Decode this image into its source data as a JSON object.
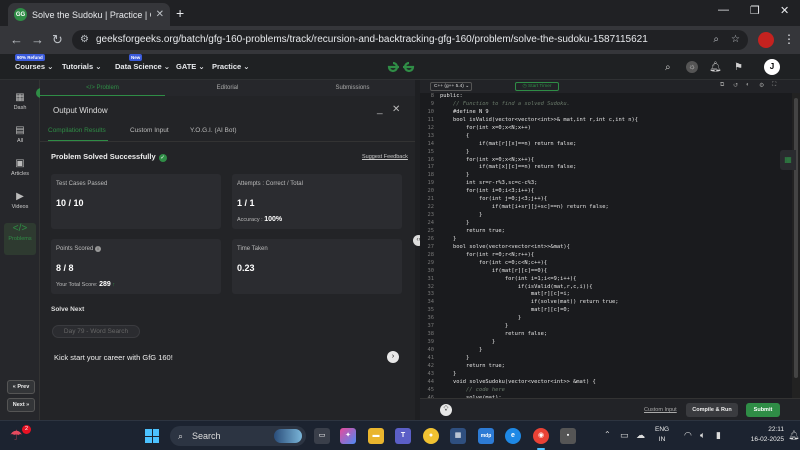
{
  "browser": {
    "tab_title": "Solve the Sudoku | Practice | Ge",
    "new_tab": "+",
    "url": "geeksforgeeks.org/batch/gfg-160-problems/track/recursion-and-backtracking-gfg-160/problem/solve-the-sudoku-1587115621"
  },
  "gfg_header": {
    "nav": [
      {
        "label": "Courses ⌄",
        "badge": "90% Refund"
      },
      {
        "label": "Tutorials ⌄",
        "badge": ""
      },
      {
        "label": "Data Science ⌄",
        "badge": "New"
      },
      {
        "label": "GATE ⌄",
        "badge": ""
      },
      {
        "label": "Practice ⌄",
        "badge": ""
      }
    ],
    "avatar_letter": "J"
  },
  "rail": {
    "items": [
      {
        "label": "Dash",
        "icon": "dashboard-icon"
      },
      {
        "label": "All",
        "icon": "grid-icon"
      },
      {
        "label": "Articles",
        "icon": "article-icon"
      },
      {
        "label": "Videos",
        "icon": "video-icon"
      },
      {
        "label": "Problems",
        "icon": "code-icon"
      }
    ],
    "prev": "« Prev",
    "next": "Next »"
  },
  "problem_tabs": [
    "</> Problem",
    "Editorial",
    "Submissions"
  ],
  "output": {
    "title": "Output Window",
    "tabs": [
      "Compilation Results",
      "Custom Input",
      "Y.O.G.I. (AI Bot)"
    ],
    "status": "Problem Solved Successfully",
    "feedback": "Suggest Feedback",
    "cards": {
      "tests_label": "Test Cases Passed",
      "tests_value": "10 / 10",
      "attempts_label": "Attempts : Correct / Total",
      "attempts_value": "1 / 1",
      "accuracy_label": "Accuracy :",
      "accuracy_value": "100%",
      "points_label": "Points Scored",
      "points_value": "8 / 8",
      "total_label": "Your Total Score:",
      "total_value": "289",
      "time_label": "Time Taken",
      "time_value": "0.23"
    },
    "solve_next": "Solve Next",
    "potd": "Day 79 - Word Search",
    "kickstart": "Kick start your career with GfG 160!"
  },
  "editor": {
    "language": "C++ (g++ 5.4)",
    "timer": "Start Timer",
    "lines": [
      {
        "n": "8",
        "t": "public:",
        "c": "kw"
      },
      {
        "n": "9",
        "t": "    // Function to find a solved Sudoku.",
        "c": "cm"
      },
      {
        "n": "10",
        "t": "    #define N 9",
        "c": "kw"
      },
      {
        "n": "11",
        "t": "    bool isValid(vector<vector<int>>& mat,int r,int c,int n){",
        "c": "kw"
      },
      {
        "n": "12",
        "t": "        for(int x=0;x<N;x++)",
        "c": "kw"
      },
      {
        "n": "13",
        "t": "        {",
        "c": "kw"
      },
      {
        "n": "14",
        "t": "            if(mat[r][x]==n) return false;",
        "c": "kw"
      },
      {
        "n": "15",
        "t": "        }",
        "c": "kw"
      },
      {
        "n": "16",
        "t": "        for(int x=0;x<N;x++){",
        "c": "kw"
      },
      {
        "n": "17",
        "t": "            if(mat[x][c]==n) return false;",
        "c": "kw"
      },
      {
        "n": "18",
        "t": "        }",
        "c": "kw"
      },
      {
        "n": "19",
        "t": "        int sr=r-r%3,sc=c-c%3;",
        "c": "kw"
      },
      {
        "n": "20",
        "t": "        for(int i=0;i<3;i++){",
        "c": "kw"
      },
      {
        "n": "21",
        "t": "            for(int j=0;j<3;j++){",
        "c": "kw"
      },
      {
        "n": "22",
        "t": "                if(mat[i+sr][j+sc]==n) return false;",
        "c": "kw"
      },
      {
        "n": "23",
        "t": "            }",
        "c": "kw"
      },
      {
        "n": "24",
        "t": "        }",
        "c": "kw"
      },
      {
        "n": "25",
        "t": "        return true;",
        "c": "kw"
      },
      {
        "n": "26",
        "t": "    }",
        "c": "kw"
      },
      {
        "n": "27",
        "t": "    bool solve(vector<vector<int>>&mat){",
        "c": "kw"
      },
      {
        "n": "28",
        "t": "        for(int r=0;r<N;r++){",
        "c": "kw"
      },
      {
        "n": "29",
        "t": "            for(int c=0;c<N;c++){",
        "c": "kw"
      },
      {
        "n": "30",
        "t": "                if(mat[r][c]==0){",
        "c": "kw"
      },
      {
        "n": "31",
        "t": "                    for(int i=1;i<=9;i++){",
        "c": "kw"
      },
      {
        "n": "32",
        "t": "                        if(isValid(mat,r,c,i)){",
        "c": "kw"
      },
      {
        "n": "33",
        "t": "                            mat[r][c]=i;",
        "c": "kw"
      },
      {
        "n": "34",
        "t": "                            if(solve(mat)) return true;",
        "c": "kw"
      },
      {
        "n": "35",
        "t": "                            mat[r][c]=0;",
        "c": "kw"
      },
      {
        "n": "36",
        "t": "                        }",
        "c": "kw"
      },
      {
        "n": "37",
        "t": "                    }",
        "c": "kw"
      },
      {
        "n": "38",
        "t": "                    return false;",
        "c": "kw"
      },
      {
        "n": "39",
        "t": "                }",
        "c": "kw"
      },
      {
        "n": "40",
        "t": "            }",
        "c": "kw"
      },
      {
        "n": "41",
        "t": "        }",
        "c": "kw"
      },
      {
        "n": "42",
        "t": "        return true;",
        "c": "kw"
      },
      {
        "n": "43",
        "t": "    }",
        "c": "kw"
      },
      {
        "n": "44",
        "t": "    void solveSudoku(vector<vector<int>> &mat) {",
        "c": "kw"
      },
      {
        "n": "45",
        "t": "        // code here",
        "c": "cm"
      },
      {
        "n": "46",
        "t": "        solve(mat);",
        "c": "kw"
      },
      {
        "n": "47",
        "t": "    }",
        "c": "kw"
      },
      {
        "n": "48",
        "t": "};",
        "c": "kw"
      }
    ],
    "custom_input": "Custom Input",
    "compile": "Compile & Run",
    "submit": "Submit"
  },
  "taskbar": {
    "weather_badge": "2",
    "search": "Search",
    "lang_line1": "ENG",
    "lang_line2": "IN",
    "time": "22:11",
    "date": "16-02-2025"
  },
  "colors": {
    "accent": "#2f8d46",
    "background": "#232427"
  }
}
